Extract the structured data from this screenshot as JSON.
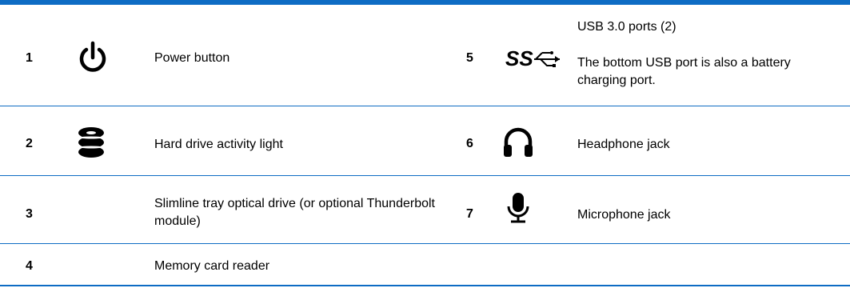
{
  "rows": [
    {
      "left": {
        "number": "1",
        "icon": "power-icon",
        "text": "Power button"
      },
      "right": {
        "number": "5",
        "icon": "superspeed-usb-icon",
        "text_title": "USB 3.0 ports (2)",
        "text_note": "The bottom USB port is also a battery charging port."
      }
    },
    {
      "left": {
        "number": "2",
        "icon": "hard-drive-icon",
        "text": "Hard drive activity light"
      },
      "right": {
        "number": "6",
        "icon": "headphone-icon",
        "text": "Headphone jack"
      }
    },
    {
      "left": {
        "number": "3",
        "icon": "",
        "text": "Slimline tray optical drive (or optional Thunderbolt module)"
      },
      "right": {
        "number": "7",
        "icon": "microphone-icon",
        "text": "Microphone jack"
      }
    },
    {
      "left": {
        "number": "4",
        "icon": "",
        "text": "Memory card reader"
      }
    }
  ],
  "colors": {
    "rule": "#0e6cc4",
    "text": "#000000"
  }
}
